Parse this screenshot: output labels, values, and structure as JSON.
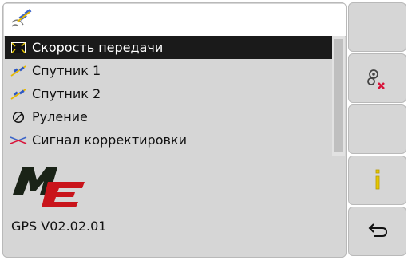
{
  "list": {
    "items": [
      {
        "label": "Скорость передачи",
        "icon": "speed-grid-icon",
        "selected": true
      },
      {
        "label": "Спутник 1",
        "icon": "satellite-icon",
        "selected": false
      },
      {
        "label": "Спутник 2",
        "icon": "satellite-icon",
        "selected": false
      },
      {
        "label": "Руление",
        "icon": "steering-icon",
        "selected": false
      },
      {
        "label": "Сигнал корректировки",
        "icon": "correction-signal-icon",
        "selected": false
      }
    ]
  },
  "version_text": "GPS V02.02.01",
  "side_buttons": [
    {
      "icon": "none"
    },
    {
      "icon": "reset-settings-icon"
    },
    {
      "icon": "none"
    },
    {
      "icon": "info-icon"
    },
    {
      "icon": "back-icon"
    }
  ],
  "colors": {
    "accent_red": "#c9141b",
    "accent_yellow": "#e6c800",
    "selected_row": "#1a1a1a"
  }
}
